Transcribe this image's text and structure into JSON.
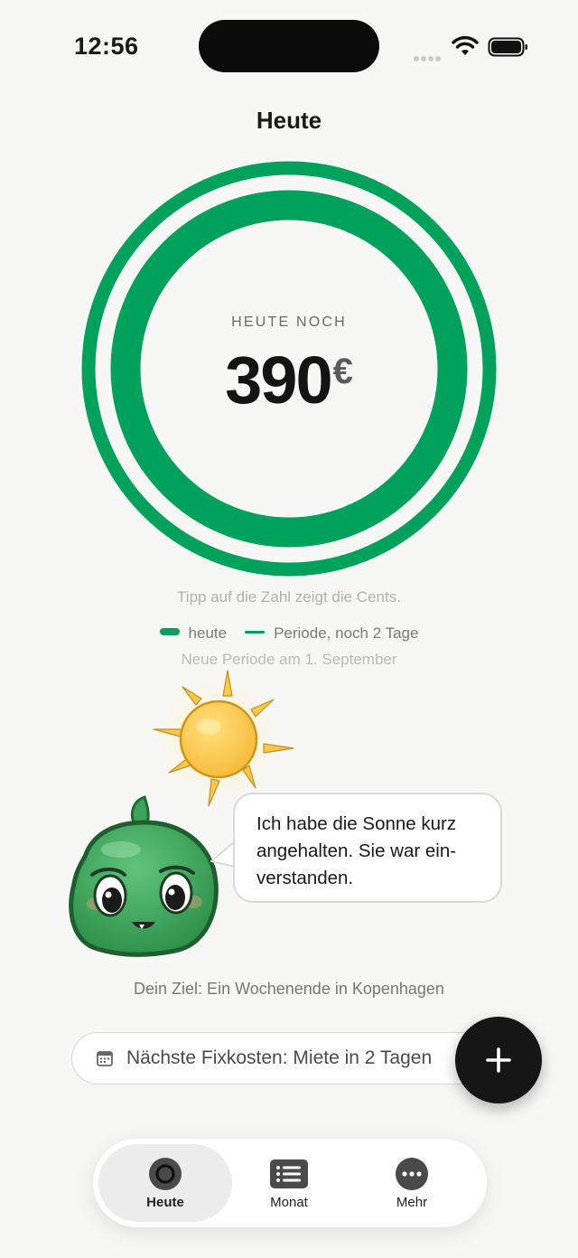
{
  "status_bar": {
    "time": "12:56"
  },
  "header": {
    "title": "Heute"
  },
  "ring": {
    "label": "HEUTE NOCH",
    "amount": "390",
    "currency": "€",
    "today_fraction": 1.0,
    "period_fraction": 1.0,
    "accent_color": "#00a15b"
  },
  "tip": "Tipp auf die Zahl zeigt die Cents.",
  "legend": {
    "today": "heute",
    "period": "Periode, noch 2 Tage"
  },
  "new_period": "Neue Periode am 1. September",
  "mascot": {
    "speech_lines": [
      "Ich habe die Sonne kurz",
      "angehalten. Sie war ein-",
      "verstanden."
    ],
    "icons": [
      "sun-icon",
      "mascot-blob-icon"
    ]
  },
  "goal": "Dein Ziel: Ein Wochenende in Kopenhagen",
  "fixed_costs": {
    "text": "Nächste Fixkosten: Miete in 2 Tagen",
    "icon": "calendar-icon"
  },
  "fab": {
    "icon": "plus-icon"
  },
  "tabbar": {
    "tabs": [
      {
        "label": "Heute",
        "icon": "circle-icon",
        "active": true
      },
      {
        "label": "Monat",
        "icon": "list-icon",
        "active": false
      },
      {
        "label": "Mehr",
        "icon": "more-icon",
        "active": false
      }
    ]
  }
}
